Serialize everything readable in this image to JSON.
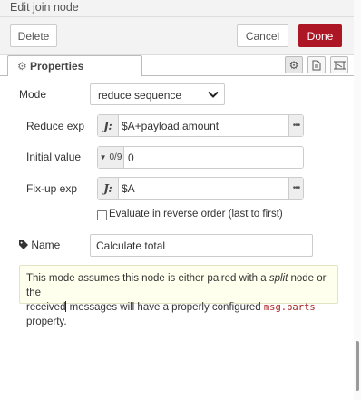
{
  "tray": {
    "title": "Edit join node"
  },
  "toolbar": {
    "delete_label": "Delete",
    "cancel_label": "Cancel",
    "done_label": "Done"
  },
  "tabs": {
    "properties_label": "Properties"
  },
  "form": {
    "mode_label": "Mode",
    "mode_value": "reduce sequence",
    "reduce_exp_label": "Reduce exp",
    "reduce_exp_type": "J:",
    "reduce_exp_value": "$A+payload.amount",
    "initial_value_label": "Initial value",
    "initial_value_type": "0/9",
    "initial_value_value": "0",
    "fixup_exp_label": "Fix-up exp",
    "fixup_exp_type": "J:",
    "fixup_exp_value": "$A",
    "reverse_label": "Evaluate in reverse order (last to first)",
    "reverse_checked": false,
    "name_label": "Name",
    "name_value": "Calculate total"
  },
  "tip": {
    "t1": "This mode assumes this node is either paired with a ",
    "t2": "split",
    "t3": " node or the",
    "t4": "received",
    "t5": " messages will have a properly configured ",
    "t6": "msg.parts",
    "t7": " property."
  },
  "icons": {
    "properties_tab": "gear-icon",
    "description_tab": "document-icon",
    "appearance_tab": "frame-icon",
    "mode_select": "chevron-down-icon",
    "name_field": "tag-icon",
    "expand": "ellipsis-icon"
  },
  "colors": {
    "primary_button": "#ad1625",
    "tip_background": "#ffffee",
    "code_text": "#aa2222"
  }
}
